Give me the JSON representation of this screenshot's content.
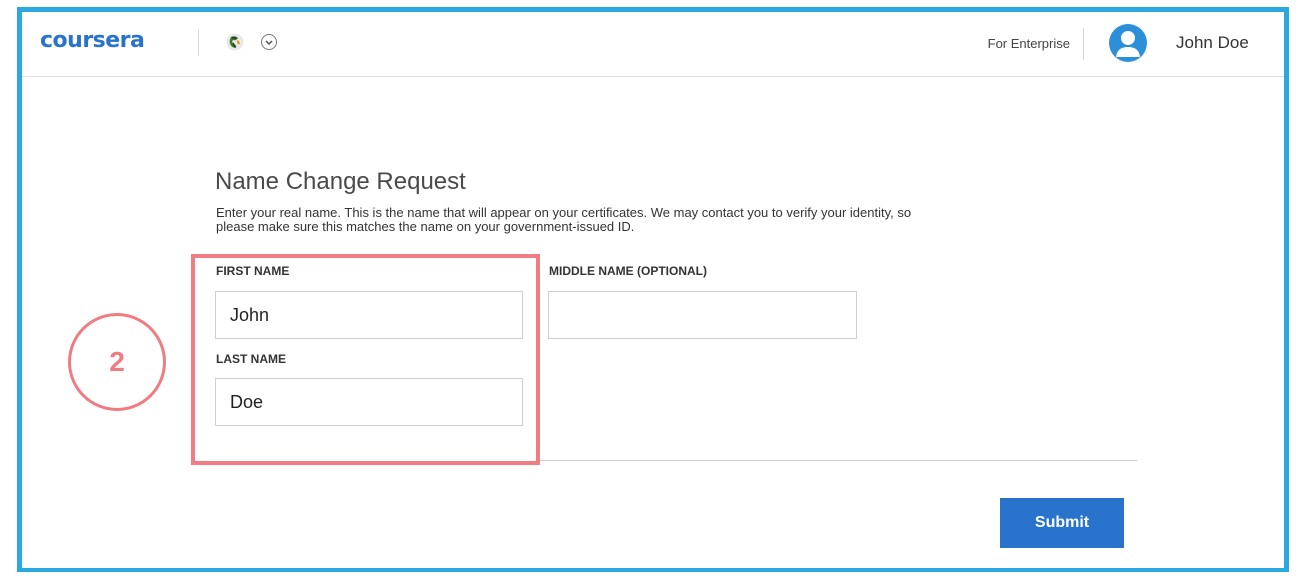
{
  "header": {
    "logo": "coursera",
    "for_enterprise": "For Enterprise",
    "user_name": "John Doe"
  },
  "form": {
    "title": "Name Change Request",
    "description": "Enter your real name. This is the name that will appear on your certificates. We may contact you to verify your identity, so please make sure this matches the name on your government-issued ID.",
    "first_name_label": "FIRST NAME",
    "first_name_value": "John",
    "middle_name_label": "MIDDLE NAME (OPTIONAL)",
    "middle_name_value": "",
    "last_name_label": "LAST NAME",
    "last_name_value": "Doe",
    "submit_label": "Submit"
  },
  "annotation": {
    "step_number": "2",
    "color": "#f07b80"
  },
  "colors": {
    "brand": "#2a73cc",
    "frame": "#29a9e0"
  }
}
